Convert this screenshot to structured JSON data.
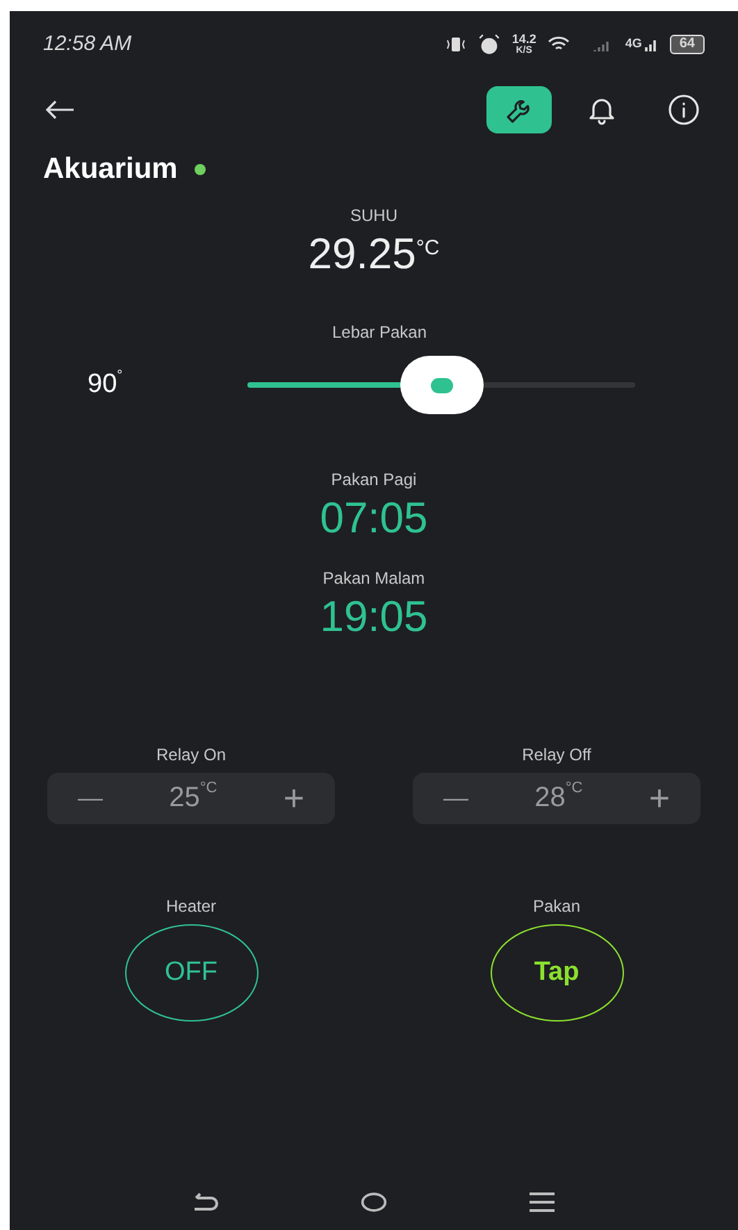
{
  "status_bar": {
    "time": "12:58 AM",
    "speed": "14.2",
    "speed_unit": "K/S",
    "network": "4G",
    "battery": "64"
  },
  "toolbar": {
    "items": [
      {
        "kind": "wrench",
        "selected": true
      },
      {
        "kind": "bell",
        "selected": false
      },
      {
        "kind": "info",
        "selected": false
      }
    ]
  },
  "device": {
    "name": "Akuarium",
    "online": true
  },
  "temperature": {
    "label": "SUHU",
    "value": "29.25",
    "unit": "°C"
  },
  "slider": {
    "label": "Lebar Pakan",
    "reading": "90",
    "unit": "°",
    "level": 0.5
  },
  "schedules": [
    {
      "label": "Pakan Pagi",
      "time": "07:05"
    },
    {
      "label": "Pakan Malam",
      "time": "19:05"
    }
  ],
  "steppers": [
    {
      "label": "Relay On",
      "minus": "—",
      "value": "25",
      "unit": "°C",
      "plus": "+"
    },
    {
      "label": "Relay Off",
      "minus": "—",
      "value": "28",
      "unit": "°C",
      "plus": "+"
    }
  ],
  "buttons": [
    {
      "label": "Heater",
      "kind": "switch",
      "text": "OFF",
      "color": "#2fc290"
    },
    {
      "label": "Pakan",
      "kind": "push",
      "text": "Tap",
      "color": "#8be02e"
    }
  ]
}
